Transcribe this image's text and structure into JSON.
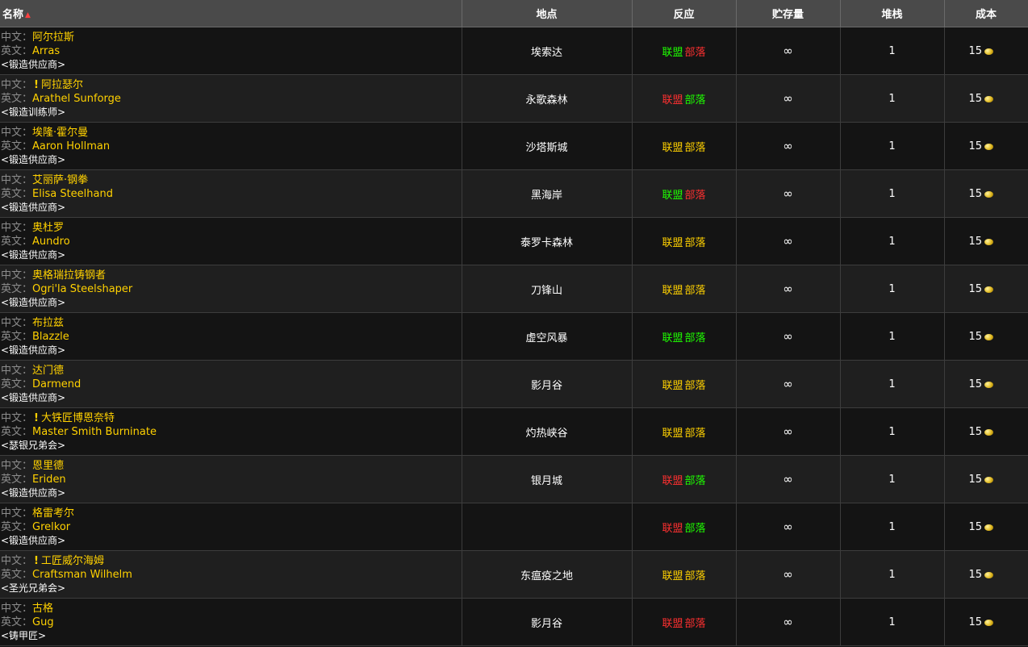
{
  "header": {
    "name": "名称",
    "location": "地点",
    "reaction": "反应",
    "stock": "贮存量",
    "stack": "堆栈",
    "cost": "成本"
  },
  "labels": {
    "cn": "中文：",
    "en": "英文：",
    "alliance": "联盟",
    "horde": "部落",
    "infinity": "∞"
  },
  "colors": {
    "friendly": "#1eff00",
    "neutral": "#ffd100",
    "hostile": "#ff3030"
  },
  "rows": [
    {
      "cn": "阿尔拉斯",
      "en": "Arras",
      "sub": "<锻造供应商>",
      "quest": false,
      "location": "埃索达",
      "alliance": "friendly",
      "horde": "hostile",
      "stock": "∞",
      "stack": "1",
      "cost": "15"
    },
    {
      "cn": "阿拉瑟尔",
      "en": "Arathel Sunforge",
      "sub": "<锻造训练师>",
      "quest": true,
      "location": "永歌森林",
      "alliance": "hostile",
      "horde": "friendly",
      "stock": "∞",
      "stack": "1",
      "cost": "15"
    },
    {
      "cn": "埃隆·霍尔曼",
      "en": "Aaron Hollman",
      "sub": "<锻造供应商>",
      "quest": false,
      "location": "沙塔斯城",
      "alliance": "neutral",
      "horde": "neutral",
      "stock": "∞",
      "stack": "1",
      "cost": "15"
    },
    {
      "cn": "艾丽萨·钢拳",
      "en": "Elisa Steelhand",
      "sub": "<锻造供应商>",
      "quest": false,
      "location": "黑海岸",
      "alliance": "friendly",
      "horde": "hostile",
      "stock": "∞",
      "stack": "1",
      "cost": "15"
    },
    {
      "cn": "奥杜罗",
      "en": "Aundro",
      "sub": "<锻造供应商>",
      "quest": false,
      "location": "泰罗卡森林",
      "alliance": "neutral",
      "horde": "neutral",
      "stock": "∞",
      "stack": "1",
      "cost": "15"
    },
    {
      "cn": "奥格瑞拉铸钢者",
      "en": "Ogri'la Steelshaper",
      "sub": "<锻造供应商>",
      "quest": false,
      "location": "刀锋山",
      "alliance": "neutral",
      "horde": "neutral",
      "stock": "∞",
      "stack": "1",
      "cost": "15"
    },
    {
      "cn": "布拉兹",
      "en": "Blazzle",
      "sub": "<锻造供应商>",
      "quest": false,
      "location": "虚空风暴",
      "alliance": "friendly",
      "horde": "friendly",
      "stock": "∞",
      "stack": "1",
      "cost": "15"
    },
    {
      "cn": "达门德",
      "en": "Darmend",
      "sub": "<锻造供应商>",
      "quest": false,
      "location": "影月谷",
      "alliance": "neutral",
      "horde": "neutral",
      "stock": "∞",
      "stack": "1",
      "cost": "15"
    },
    {
      "cn": "大铁匠博恩奈特",
      "en": "Master Smith Burninate",
      "sub": "<瑟银兄弟会>",
      "quest": true,
      "location": "灼热峡谷",
      "alliance": "neutral",
      "horde": "neutral",
      "stock": "∞",
      "stack": "1",
      "cost": "15"
    },
    {
      "cn": "恩里德",
      "en": "Eriden",
      "sub": "<锻造供应商>",
      "quest": false,
      "location": "银月城",
      "alliance": "hostile",
      "horde": "friendly",
      "stock": "∞",
      "stack": "1",
      "cost": "15"
    },
    {
      "cn": "格雷考尔",
      "en": "Grelkor",
      "sub": "<锻造供应商>",
      "quest": false,
      "location": "",
      "alliance": "hostile",
      "horde": "friendly",
      "stock": "∞",
      "stack": "1",
      "cost": "15"
    },
    {
      "cn": "工匠威尔海姆",
      "en": "Craftsman Wilhelm",
      "sub": "<圣光兄弟会>",
      "quest": true,
      "location": "东瘟疫之地",
      "alliance": "neutral",
      "horde": "neutral",
      "stock": "∞",
      "stack": "1",
      "cost": "15"
    },
    {
      "cn": "古格",
      "en": "Gug",
      "sub": "<铸甲匠>",
      "quest": false,
      "location": "影月谷",
      "alliance": "hostile",
      "horde": "hostile",
      "stock": "∞",
      "stack": "1",
      "cost": "15"
    }
  ]
}
